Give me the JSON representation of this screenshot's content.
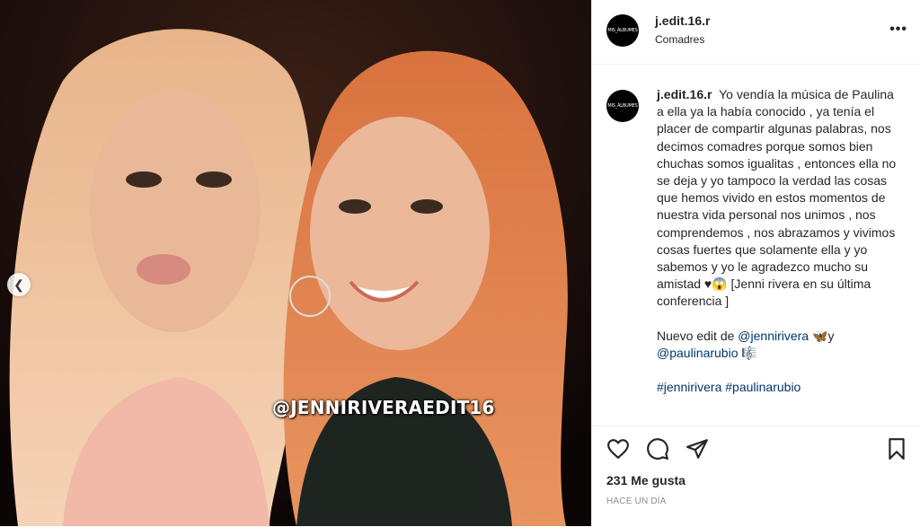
{
  "post": {
    "username": "j.edit.16.r",
    "location": "Comadres",
    "avatar_text": "MIS_ÁLBUMES",
    "more_label": "•••",
    "watermark": "@JENNIRIVERAEDIT16",
    "caption": {
      "username": "j.edit.16.r",
      "text": "Yo vendía la música de Paulina a ella ya la había conocido , ya tenía el placer de compartir algunas palabras, nos decimos comadres porque somos bien chuchas somos igualitas , entonces ella no se deja y yo tampoco la verdad las cosas que hemos vivido en estos momentos de nuestra vida personal nos unimos , nos comprendemos , nos abrazamos y vivimos cosas fuertes que solamente ella y yo sabemos y yo le agradezco mucho su amistad ♥😱 [Jenni rivera en su última conferencia ]",
      "edit_prefix": "Nuevo edit de",
      "mention1": "@jennirivera",
      "emoji1": "🦋",
      "connector": "y",
      "mention2": "@paulinarubio",
      "emoji2": "🎼",
      "hashtag1": "#jennirivera",
      "hashtag2": "#paulinarubio"
    },
    "likes": "231 Me gusta",
    "time": "HACE UN DÍA"
  },
  "icons": {
    "prev": "chevron-left-icon",
    "like": "heart-icon",
    "comment": "comment-icon",
    "share": "share-icon",
    "save": "bookmark-icon"
  },
  "colors": {
    "link": "#00376b",
    "text": "#262626",
    "muted": "#8e8e8e",
    "border": "#efefef"
  }
}
